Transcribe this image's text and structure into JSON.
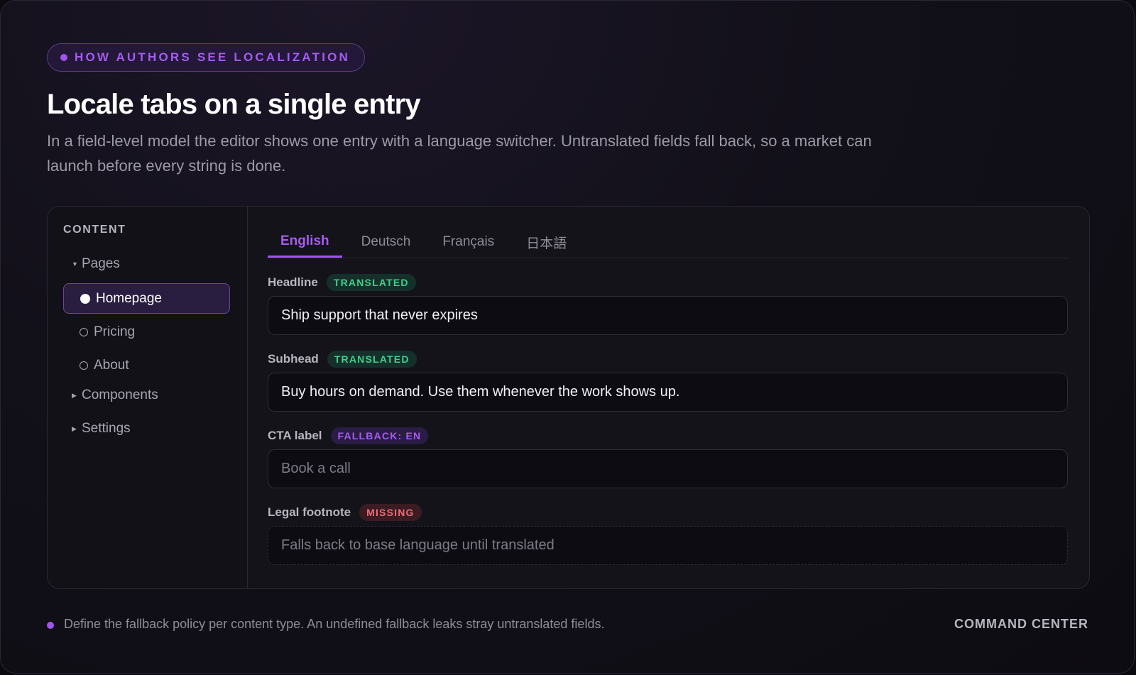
{
  "eyebrow": {
    "label": "HOW AUTHORS SEE LOCALIZATION"
  },
  "title": "Locale tabs on a single entry",
  "description": "In a field-level model the editor shows one entry with a language switcher. Untranslated fields fall back, so a market can launch before every string is done.",
  "sidebar": {
    "heading": "CONTENT",
    "pages_group": "Pages",
    "pages": [
      "Homepage",
      "Pricing",
      "About"
    ],
    "active_page": "Homepage",
    "components_group": "Components",
    "settings_group": "Settings"
  },
  "tabs": [
    "English",
    "Deutsch",
    "Français",
    "日本語"
  ],
  "active_tab": "English",
  "fields": [
    {
      "label": "Headline",
      "status": "TRANSLATED",
      "value": "Ship support that never expires"
    },
    {
      "label": "Subhead",
      "status": "TRANSLATED",
      "value": "Buy hours on demand. Use them whenever the work shows up."
    },
    {
      "label": "CTA label",
      "status": "FALLBACK: EN",
      "placeholder": "Book a call"
    },
    {
      "label": "Legal footnote",
      "status": "MISSING",
      "placeholder": "Falls back to base language until translated"
    }
  ],
  "colors": {
    "accent": "#a155f0",
    "translated": "#3fcf8e",
    "missing": "#f06b78"
  },
  "footer": {
    "note": "Define the fallback policy per content type. An undefined fallback leaks stray untranslated fields.",
    "brand": "COMMAND CENTER"
  }
}
